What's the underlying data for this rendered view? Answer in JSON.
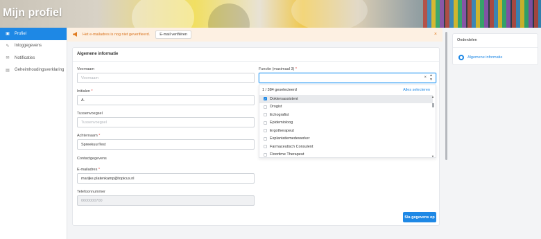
{
  "header": {
    "title": "Mijn profiel"
  },
  "sidebar": {
    "items": [
      {
        "label": "Profiel",
        "icon": "id-card-icon",
        "glyph": "▣"
      },
      {
        "label": "Inloggegevens",
        "icon": "key-icon",
        "glyph": "✎"
      },
      {
        "label": "Notificaties",
        "icon": "envelope-icon",
        "glyph": "✉"
      },
      {
        "label": "Geheimhoudingsverklaring",
        "icon": "document-icon",
        "glyph": "▤"
      }
    ]
  },
  "alert": {
    "message": "Het e-mailadres is nog niet geverifieerd.",
    "verify_label": "E-mail verifiëren",
    "close_glyph": "×",
    "icon": "megaphone-icon"
  },
  "form": {
    "title": "Algemene informatie",
    "voornaam": {
      "label": "Voornaam",
      "value": "",
      "placeholder": "Voornaam"
    },
    "initialen": {
      "label": "Initialen",
      "value": "A."
    },
    "tussenvoegsel": {
      "label": "Tussenvoegsel",
      "value": "",
      "placeholder": "Tussenvoegsel"
    },
    "achternaam": {
      "label": "Achternaam",
      "value": "SpreekuurTest"
    },
    "contact_head": "Contactgegevens",
    "email": {
      "label": "E-mailadres",
      "value": "marijke.platenkamp@topicus.nl"
    },
    "telefoon": {
      "label": "Telefoonnummer",
      "value": "",
      "placeholder": "0600000700"
    },
    "functie": {
      "label": "Functie (maximaal 3)",
      "clear_glyph": "×",
      "count_text": "1 / 384 geselecteerd",
      "select_all": "Alles selecteren",
      "options": [
        {
          "label": "Doktersassistent",
          "selected": true
        },
        {
          "label": "Drogist",
          "selected": false
        },
        {
          "label": "Echografist",
          "selected": false
        },
        {
          "label": "Epidemioloog",
          "selected": false
        },
        {
          "label": "Ergotherapeut",
          "selected": false
        },
        {
          "label": "Explantatiemedewerker",
          "selected": false
        },
        {
          "label": "Farmaceutisch Consulent",
          "selected": false
        },
        {
          "label": "Floortime Therapeut",
          "selected": false
        }
      ]
    },
    "save_label": "Sla gegevens op",
    "required_mark": "*"
  },
  "toc": {
    "title": "Onderdelen",
    "item": "Algemene informatie"
  },
  "colors": {
    "accent": "#1e88e5",
    "alert_text": "#d9731d",
    "alert_bg": "#fdf0e2"
  }
}
